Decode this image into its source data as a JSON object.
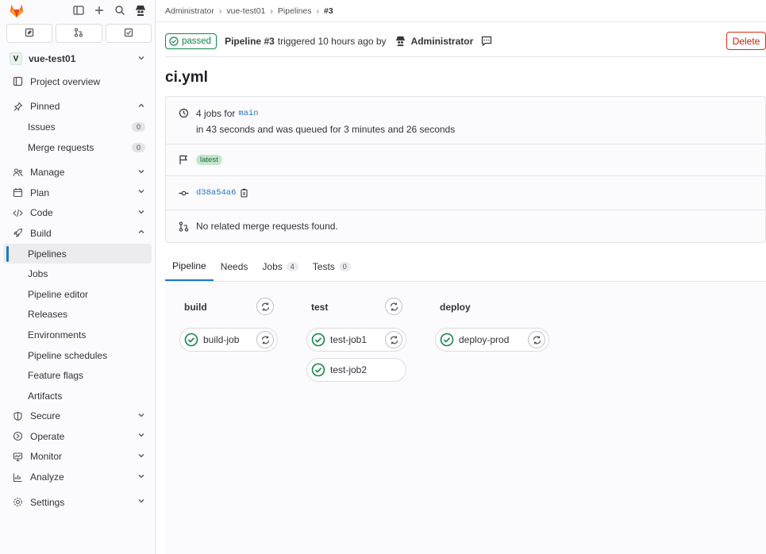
{
  "sidebar": {
    "project_initial": "V",
    "project_name": "vue-test01",
    "items": [
      {
        "label": "Project overview"
      },
      {
        "label": "Pinned"
      },
      {
        "label": "Issues",
        "badge": "0"
      },
      {
        "label": "Merge requests",
        "badge": "0"
      },
      {
        "label": "Manage"
      },
      {
        "label": "Plan"
      },
      {
        "label": "Code"
      },
      {
        "label": "Build"
      },
      {
        "label": "Pipelines"
      },
      {
        "label": "Jobs"
      },
      {
        "label": "Pipeline editor"
      },
      {
        "label": "Releases"
      },
      {
        "label": "Environments"
      },
      {
        "label": "Pipeline schedules"
      },
      {
        "label": "Feature flags"
      },
      {
        "label": "Artifacts"
      },
      {
        "label": "Secure"
      },
      {
        "label": "Operate"
      },
      {
        "label": "Monitor"
      },
      {
        "label": "Analyze"
      },
      {
        "label": "Settings"
      }
    ]
  },
  "breadcrumb": [
    "Administrator",
    "vue-test01",
    "Pipelines",
    "#3"
  ],
  "header": {
    "status": "passed",
    "pipeline": "Pipeline #3",
    "triggered": "triggered 10 hours ago by",
    "user": "Administrator",
    "delete_label": "Delete"
  },
  "title": "ci.yml",
  "info": {
    "jobs_prefix": "4 jobs for",
    "branch": "main",
    "duration": "in 43 seconds and was queued for 3 minutes and 26 seconds",
    "tag": "latest",
    "commit": "d38a54a6",
    "mr_text": "No related merge requests found."
  },
  "tabs": [
    {
      "label": "Pipeline"
    },
    {
      "label": "Needs"
    },
    {
      "label": "Jobs",
      "count": "4"
    },
    {
      "label": "Tests",
      "count": "0"
    }
  ],
  "stages": [
    {
      "name": "build",
      "jobs": [
        "build-job"
      ]
    },
    {
      "name": "test",
      "jobs": [
        "test-job1",
        "test-job2"
      ]
    },
    {
      "name": "deploy",
      "jobs": [
        "deploy-prod"
      ]
    }
  ],
  "colors": {
    "success": "#108548",
    "accent": "#1f75cb",
    "danger": "#dd2b0e"
  }
}
